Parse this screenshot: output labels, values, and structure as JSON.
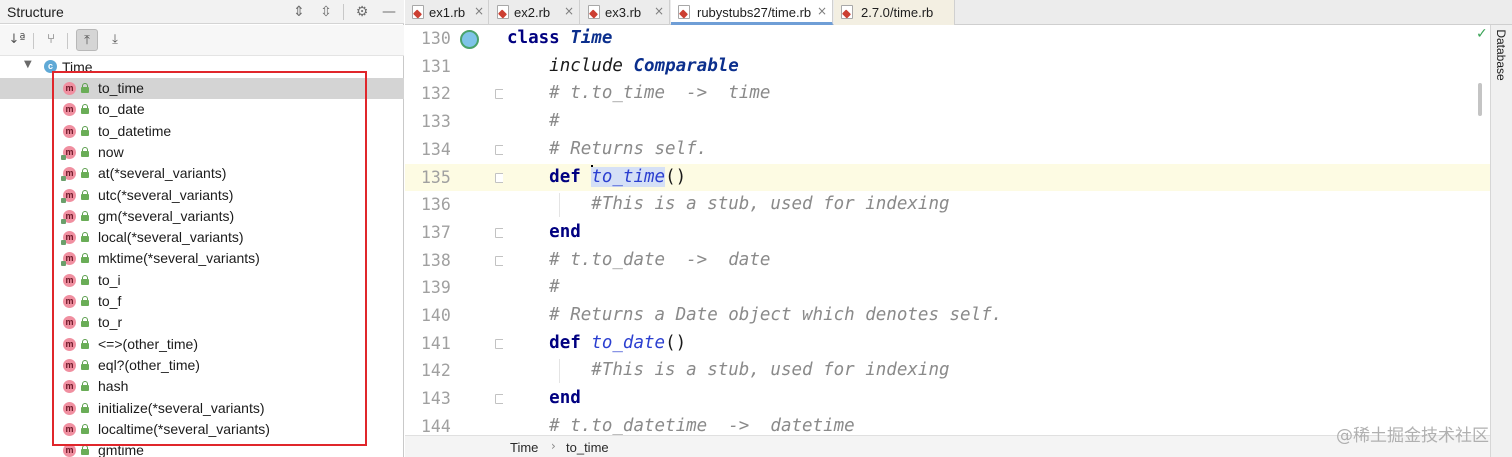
{
  "structure": {
    "title": "Structure",
    "header_icons": [
      "expand-all-icon",
      "collapse-all-icon",
      "gear-icon",
      "minimize-icon"
    ],
    "toolbar": [
      "sort-alpha-icon",
      "filter-icon",
      "autoscroll-to-source-icon",
      "autoscroll-from-source-icon"
    ],
    "root": {
      "badge": "c",
      "label": "Time"
    },
    "items": [
      {
        "label": "to_time",
        "badge": "m",
        "static": false
      },
      {
        "label": "to_date",
        "badge": "m",
        "static": false
      },
      {
        "label": "to_datetime",
        "badge": "m",
        "static": false
      },
      {
        "label": "now",
        "badge": "m",
        "static": true
      },
      {
        "label": "at(*several_variants)",
        "badge": "m",
        "static": true
      },
      {
        "label": "utc(*several_variants)",
        "badge": "m",
        "static": true
      },
      {
        "label": "gm(*several_variants)",
        "badge": "m",
        "static": true
      },
      {
        "label": "local(*several_variants)",
        "badge": "m",
        "static": true
      },
      {
        "label": "mktime(*several_variants)",
        "badge": "m",
        "static": true
      },
      {
        "label": "to_i",
        "badge": "m",
        "static": false
      },
      {
        "label": "to_f",
        "badge": "m",
        "static": false
      },
      {
        "label": "to_r",
        "badge": "m",
        "static": false
      },
      {
        "label": "<=>(other_time)",
        "badge": "m",
        "static": false
      },
      {
        "label": "eql?(other_time)",
        "badge": "m",
        "static": false
      },
      {
        "label": "hash",
        "badge": "m",
        "static": false
      },
      {
        "label": "initialize(*several_variants)",
        "badge": "m",
        "static": false
      },
      {
        "label": "localtime(*several_variants)",
        "badge": "m",
        "static": false
      },
      {
        "label": "gmtime",
        "badge": "m",
        "static": false
      }
    ]
  },
  "tabs": [
    {
      "label": "ex1.rb",
      "close": "×"
    },
    {
      "label": "ex2.rb",
      "close": "×"
    },
    {
      "label": "ex3.rb",
      "close": "×"
    },
    {
      "label": "rubystubs27/time.rb",
      "close": "×"
    },
    {
      "label": "2.7.0/time.rb",
      "close": "×"
    }
  ],
  "editor": {
    "line_numbers": [
      "130",
      "131",
      "132",
      "133",
      "134",
      "135",
      "136",
      "137",
      "138",
      "139",
      "140",
      "141",
      "142",
      "143",
      "144"
    ],
    "lines": [
      [
        {
          "t": "class",
          "c": "kw"
        },
        {
          "t": " "
        },
        {
          "t": "Time",
          "c": "cls"
        }
      ],
      [
        {
          "t": "    "
        },
        {
          "t": "include",
          "c": "kwi"
        },
        {
          "t": " "
        },
        {
          "t": "Comparable",
          "c": "cls"
        }
      ],
      [
        {
          "t": "    "
        },
        {
          "t": "# t.to_time  ->  time",
          "c": "cmt"
        }
      ],
      [
        {
          "t": "    "
        },
        {
          "t": "#",
          "c": "cmt"
        }
      ],
      [
        {
          "t": "    "
        },
        {
          "t": "# Returns self.",
          "c": "cmt"
        }
      ],
      [
        {
          "t": "    "
        },
        {
          "t": "def",
          "c": "kw"
        },
        {
          "t": " "
        },
        {
          "t": "",
          "c": "caret"
        },
        {
          "t": "to_time",
          "c": "fn sel"
        },
        {
          "t": "()"
        }
      ],
      [
        {
          "t": "        "
        },
        {
          "t": "#This is a stub, used for indexing",
          "c": "cmt"
        }
      ],
      [
        {
          "t": "    "
        },
        {
          "t": "end",
          "c": "kw"
        }
      ],
      [
        {
          "t": "    "
        },
        {
          "t": "# t.to_date  ->  date",
          "c": "cmt"
        }
      ],
      [
        {
          "t": "    "
        },
        {
          "t": "#",
          "c": "cmt"
        }
      ],
      [
        {
          "t": "    "
        },
        {
          "t": "# Returns a Date object which denotes self.",
          "c": "cmt"
        }
      ],
      [
        {
          "t": "    "
        },
        {
          "t": "def",
          "c": "kw"
        },
        {
          "t": " "
        },
        {
          "t": "to_date",
          "c": "fn"
        },
        {
          "t": "()"
        }
      ],
      [
        {
          "t": "        "
        },
        {
          "t": "#This is a stub, used for indexing",
          "c": "cmt"
        }
      ],
      [
        {
          "t": "    "
        },
        {
          "t": "end",
          "c": "kw"
        }
      ],
      [
        {
          "t": "    "
        },
        {
          "t": "# t.to_datetime  ->  datetime",
          "c": "cmt"
        }
      ]
    ],
    "current_line": "135",
    "fold_lines": [
      "132",
      "134",
      "135",
      "137",
      "138",
      "141",
      "143"
    ]
  },
  "side_panel": {
    "database_label": "Database",
    "status_icon": "✓"
  },
  "breadcrumb": {
    "class": "Time",
    "separator": "›",
    "method": "to_time"
  },
  "watermark": "@稀土掘金技术社区"
}
